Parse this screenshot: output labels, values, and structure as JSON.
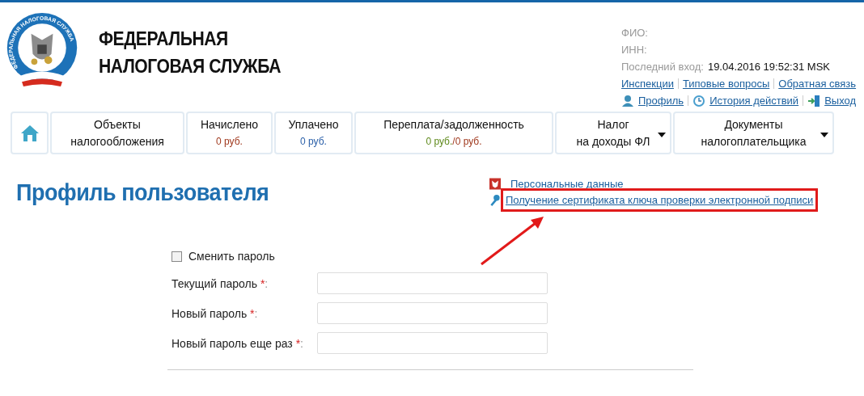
{
  "header": {
    "logo_ring_text": "ФЕДЕРАЛЬНАЯ НАЛОГОВАЯ СЛУЖБА",
    "title_lines": [
      "ФЕДЕРАЛЬНАЯ",
      "НАЛОГОВАЯ СЛУЖБА"
    ]
  },
  "user": {
    "fields": [
      {
        "label": "ФИО:"
      },
      {
        "label": "ИНН:"
      },
      {
        "label": "Последний вход:",
        "value": "19.04.2016 19:52:31 MSK"
      }
    ],
    "links": [
      {
        "label": "Инспекции"
      },
      {
        "label": "Типовые вопросы"
      },
      {
        "label": "Обратная связь"
      }
    ],
    "actions": [
      {
        "kind": "profile",
        "label": "Профиль"
      },
      {
        "kind": "history",
        "label": "История действий"
      },
      {
        "kind": "logout",
        "label": "Выход"
      }
    ]
  },
  "nav": [
    {
      "kind": "home"
    },
    {
      "kind": "tab",
      "lines": [
        "Объекты",
        "налогообложения"
      ],
      "dropdown": false
    },
    {
      "kind": "tab",
      "lines": [
        "Начислено"
      ],
      "amounts": [
        {
          "text": "0 руб.",
          "color": "#a0391e"
        }
      ],
      "dropdown": false
    },
    {
      "kind": "tab",
      "lines": [
        "Уплачено"
      ],
      "amounts": [
        {
          "text": "0 руб.",
          "color": "#2a5fa8"
        }
      ],
      "dropdown": false
    },
    {
      "kind": "tab",
      "lines": [
        "Переплата/задолженность"
      ],
      "amounts": [
        {
          "text": "0 руб.",
          "color": "#5f8a1c"
        },
        {
          "text": "/0 руб.",
          "color": "#a0391e"
        }
      ],
      "dropdown": false
    },
    {
      "kind": "tab",
      "lines": [
        "Налог",
        "на доходы ФЛ"
      ],
      "dropdown": true
    },
    {
      "kind": "tab",
      "lines": [
        "Документы",
        "налогоплательщика"
      ],
      "dropdown": true
    }
  ],
  "page_title": "Профиль пользователя",
  "side_links": [
    {
      "kind": "emblem",
      "label": "Персональные данные",
      "highlighted": false
    },
    {
      "kind": "key",
      "label": "Получение сертификата ключа проверки электронной подписи",
      "highlighted": true
    }
  ],
  "form": {
    "change_password": {
      "label": "Сменить пароль",
      "checked": false
    },
    "fields": [
      {
        "label": "Текущий пароль",
        "required": true,
        "required_mark": "*",
        "colon": ":"
      },
      {
        "label": "Новый пароль",
        "required": true,
        "required_mark": "*",
        "colon": ":"
      },
      {
        "label": "Новый пароль еще раз",
        "required": true,
        "required_mark": "*",
        "colon": ":"
      }
    ]
  }
}
